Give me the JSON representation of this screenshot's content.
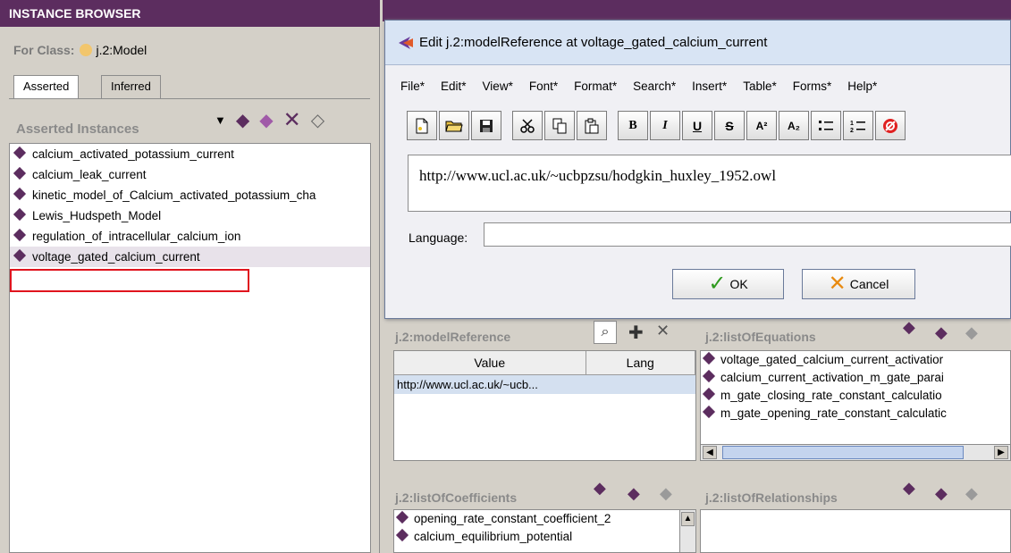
{
  "instance_browser": {
    "title": "INSTANCE BROWSER",
    "for_class_label": "For Class:",
    "class_name": "j.2:Model",
    "tabs": [
      "Asserted",
      "Inferred"
    ],
    "instances_header": "Asserted Instances",
    "instances": [
      "calcium_activated_potassium_current",
      "calcium_leak_current",
      "kinetic_model_of_Calcium_activated_potassium_cha",
      "Lewis_Hudspeth_Model",
      "regulation_of_intracellular_calcium_ion",
      "voltage_gated_calcium_current"
    ],
    "selected_index": 5
  },
  "dialog": {
    "title": "Edit j.2:modelReference at voltage_gated_calcium_current",
    "menus": [
      "File*",
      "Edit*",
      "View*",
      "Font*",
      "Format*",
      "Search*",
      "Insert*",
      "Table*",
      "Forms*",
      "Help*"
    ],
    "url_text": "http://www.ucl.ac.uk/~ucbpzsu/hodgkin_huxley_1952.owl",
    "language_label": "Language:",
    "language_value": "",
    "ok_label": "OK",
    "cancel_label": "Cancel",
    "toolbar_text": {
      "bold": "B",
      "italic": "I",
      "underline": "U",
      "strike": "S",
      "superscript": "A²",
      "subscript": "A₂"
    }
  },
  "editor": {
    "model_reference": {
      "title": "j.2:modelReference",
      "columns": [
        "Value",
        "Lang"
      ],
      "rows": [
        {
          "value": "http://www.ucl.ac.uk/~ucb...",
          "lang": ""
        }
      ]
    },
    "list_of_equations": {
      "title": "j.2:listOfEquations",
      "items": [
        "voltage_gated_calcium_current_activatior",
        "calcium_current_activation_m_gate_parai",
        "m_gate_closing_rate_constant_calculatio",
        "m_gate_opening_rate_constant_calculatic"
      ]
    },
    "list_of_coefficients": {
      "title": "j.2:listOfCoefficients",
      "items": [
        "opening_rate_constant_coefficient_2",
        "calcium_equilibrium_potential"
      ]
    },
    "list_of_relationships": {
      "title": "j.2:listOfRelationships",
      "items": []
    }
  },
  "colors": {
    "header_purple": "#5c2d5f",
    "instance_diamond": "#5c2d5f",
    "selection_outline": "#e0141e",
    "class_dot": "#f2c66d"
  }
}
